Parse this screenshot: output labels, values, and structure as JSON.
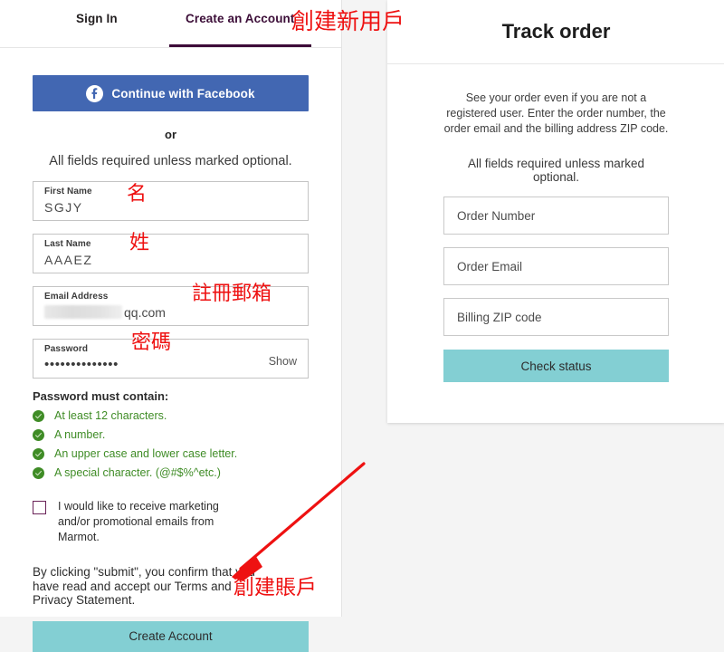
{
  "left_panel": {
    "tabs": [
      {
        "label": "Sign In",
        "active": false
      },
      {
        "label": "Create an Account",
        "active": true
      }
    ],
    "facebook_button": {
      "label": "Continue with Facebook",
      "icon": "facebook-icon",
      "color": "#4267b2"
    },
    "or_divider": "or",
    "required_note": "All fields required unless marked optional.",
    "fields": {
      "first_name": {
        "label": "First Name",
        "value": "SGJY"
      },
      "last_name": {
        "label": "Last Name",
        "value": "AAAEZ"
      },
      "email": {
        "label": "Email Address",
        "value_redacted": true,
        "value_visible_suffix": "qq.com"
      },
      "password": {
        "label": "Password",
        "masked_value": "••••••••••••••",
        "show_label": "Show"
      }
    },
    "password_requirements": {
      "title": "Password must contain:",
      "items": [
        "At least 12 characters.",
        "A number.",
        "An upper case and lower case letter.",
        "A special character. (@#$%^etc.)"
      ],
      "met_color": "#3f8c26"
    },
    "marketing_optin": {
      "checked": false,
      "text": "I would like to receive marketing and/or promotional emails from Marmot."
    },
    "legal_text": "By clicking \"submit\", you confirm that you have read and accept our Terms and Privacy Statement.",
    "create_account_button": {
      "label": "Create Account",
      "color": "#83cfd3"
    }
  },
  "right_panel": {
    "title": "Track order",
    "description": "See your order even if you are not a registered user. Enter the order number, the order email and the billing address ZIP code.",
    "required_note": "All fields required unless marked optional.",
    "fields": [
      {
        "placeholder": "Order Number"
      },
      {
        "placeholder": "Order Email"
      },
      {
        "placeholder": "Billing ZIP code"
      }
    ],
    "check_status_button": {
      "label": "Check status",
      "color": "#83cfd3"
    }
  },
  "annotations": {
    "color": "#ee1111",
    "title": "創建新用戶",
    "first_name": "名",
    "last_name": "姓",
    "email": "註冊郵箱",
    "password": "密碼",
    "create_account": "創建賬戶",
    "arrow": "red-arrow-pointing-to-create-account-button"
  },
  "theme": {
    "accent_purple": "#3d0b38",
    "teal": "#83cfd3",
    "facebook_blue": "#4267b2",
    "page_background": "#f4f4f4"
  }
}
